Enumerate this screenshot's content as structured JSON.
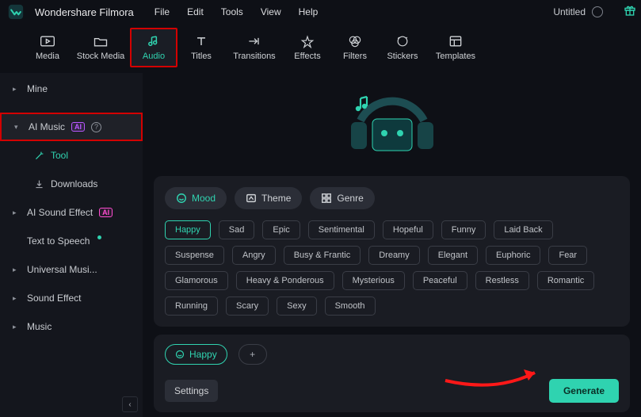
{
  "app_name": "Wondershare Filmora",
  "menu": {
    "file": "File",
    "edit": "Edit",
    "tools": "Tools",
    "view": "View",
    "help": "Help"
  },
  "project_title": "Untitled",
  "toolbar": {
    "media": "Media",
    "stock": "Stock Media",
    "audio": "Audio",
    "titles": "Titles",
    "transitions": "Transitions",
    "effects": "Effects",
    "filters": "Filters",
    "stickers": "Stickers",
    "templates": "Templates"
  },
  "sidebar": {
    "mine": "Mine",
    "ai_music": "AI Music",
    "ai_badge": "AI",
    "tool": "Tool",
    "downloads": "Downloads",
    "ai_sound": "AI Sound Effect",
    "tts": "Text to Speech",
    "universal": "Universal Musi...",
    "sound_effect": "Sound Effect",
    "music": "Music"
  },
  "tabs": {
    "mood": "Mood",
    "theme": "Theme",
    "genre": "Genre"
  },
  "moods": {
    "r1": [
      "Happy",
      "Sad",
      "Epic",
      "Sentimental",
      "Hopeful",
      "Funny",
      "Laid Back"
    ],
    "r2": [
      "Suspense",
      "Angry",
      "Busy & Frantic",
      "Dreamy",
      "Elegant",
      "Euphoric",
      "Fear"
    ],
    "r3": [
      "Glamorous",
      "Heavy & Ponderous",
      "Mysterious",
      "Peaceful",
      "Restless",
      "Romantic"
    ],
    "r4": [
      "Running",
      "Scary",
      "Sexy",
      "Smooth"
    ]
  },
  "selected_tag": "Happy",
  "settings_label": "Settings",
  "generate_label": "Generate",
  "colors": {
    "accent": "#30d3b0",
    "highlight_border": "#d30000"
  }
}
